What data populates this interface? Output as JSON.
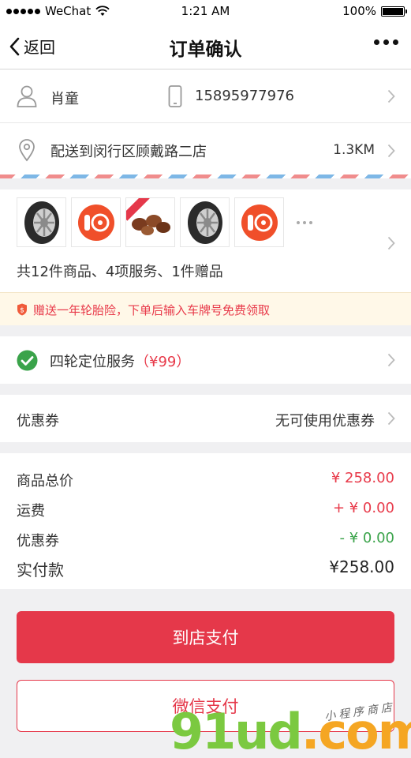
{
  "status_bar": {
    "carrier": "WeChat",
    "time": "1:21 AM",
    "battery": "100%"
  },
  "nav": {
    "back_label": "返回",
    "title": "订单确认"
  },
  "contact": {
    "name": "肖童",
    "phone": "15895977976"
  },
  "store": {
    "text": "配送到闵行区顾戴路二店",
    "distance": "1.3KM"
  },
  "products": {
    "thumbnails": [
      "tire",
      "service",
      "gift",
      "tire",
      "service"
    ],
    "summary": "共12件商品、4项服务、1件赠品"
  },
  "promo": {
    "text": "赠送一年轮胎险，下单后输入车牌号免费领取"
  },
  "service": {
    "label": "四轮定位服务",
    "price": "（¥99）"
  },
  "coupon": {
    "label": "优惠券",
    "value": "无可使用优惠券"
  },
  "totals": {
    "goods_label": "商品总价",
    "goods_value": "¥ 258.00",
    "shipping_label": "运费",
    "shipping_value": "+ ¥ 0.00",
    "coupon_label": "优惠券",
    "coupon_value": "- ¥ 0.00",
    "paid_label": "实付款",
    "paid_value": "¥258.00"
  },
  "actions": {
    "pay_at_store": "到店支付",
    "wechat_pay": "微信支付"
  },
  "watermark": {
    "main": "91ud",
    "suffix": ".com",
    "sub": "小程序商店"
  },
  "colors": {
    "accent": "#e5384a",
    "green": "#3aa34a",
    "promo_bg": "#fff8e8"
  }
}
